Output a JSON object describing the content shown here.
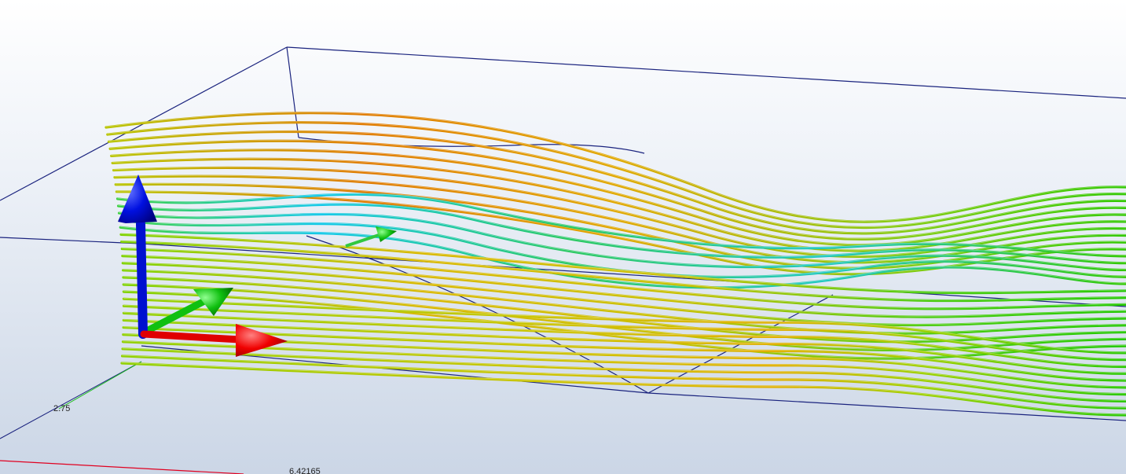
{
  "viewport": {
    "background_top": "#ffffff",
    "background_bottom": "#cbd6e6"
  },
  "axis_labels": {
    "y_tick": "2.75",
    "x_tick": "6.42165"
  },
  "colors": {
    "bounding_box": "#1a237e",
    "x_axis": "#e00000",
    "y_axis": "#00b000",
    "z_axis": "#0010d0",
    "streamline_low": "#00c8ff",
    "streamline_mid": "#22cc00",
    "streamline_high": "#e05000"
  },
  "icons": {
    "triad": "xyz-axis-triad-icon",
    "flow_arrow": "flow-direction-arrow-icon"
  }
}
